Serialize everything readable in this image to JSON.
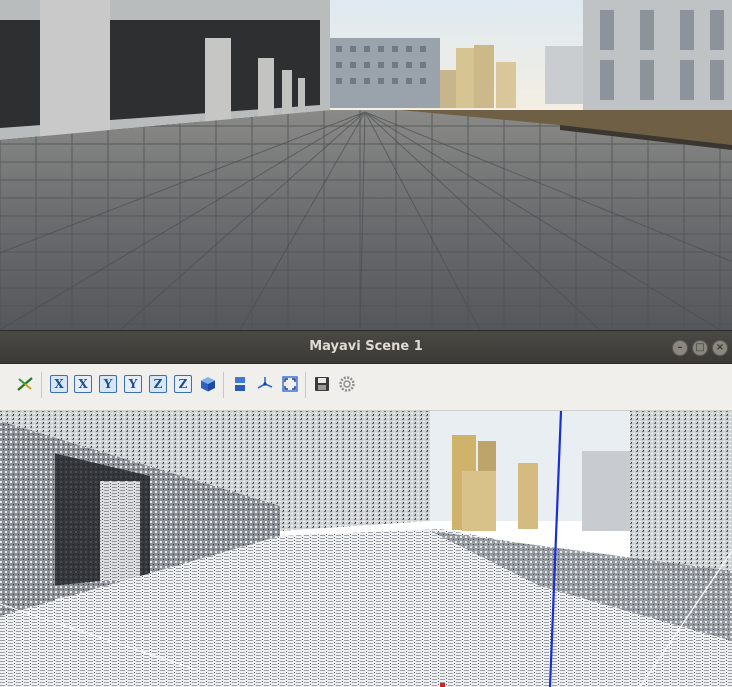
{
  "window": {
    "title": "Mayavi Scene 1",
    "controls": {
      "minimize": "–",
      "maximize": "□",
      "close": "×"
    }
  },
  "toolbar": {
    "buttons": [
      {
        "icon": "mayavi-logo-icon",
        "label": ""
      },
      {
        "icon": "view-x-positive-icon",
        "label": "X"
      },
      {
        "icon": "view-x-negative-icon",
        "label": "X"
      },
      {
        "icon": "view-y-positive-icon",
        "label": "Y"
      },
      {
        "icon": "view-y-negative-icon",
        "label": "Y"
      },
      {
        "icon": "view-z-positive-icon",
        "label": "Z"
      },
      {
        "icon": "view-z-negative-icon",
        "label": "Z"
      },
      {
        "icon": "isometric-view-icon",
        "label": ""
      },
      {
        "icon": "toggle-parallel-projection-icon",
        "label": ""
      },
      {
        "icon": "toggle-axes-icon",
        "label": ""
      },
      {
        "icon": "fullscreen-icon",
        "label": ""
      },
      {
        "icon": "save-icon",
        "label": ""
      },
      {
        "icon": "settings-icon",
        "label": ""
      }
    ]
  },
  "colors": {
    "titlebar": "#3c3b37",
    "toolbar": "#f0efec",
    "axis_blue": "#1a2fd6",
    "sky": "#e9eef2",
    "pavement": "#6e7072"
  }
}
